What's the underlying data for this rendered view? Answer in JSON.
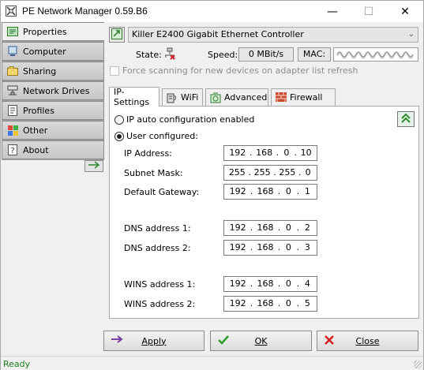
{
  "window": {
    "title": "PE Network Manager 0.59.B6",
    "min_glyph": "—",
    "max_glyph": "☐",
    "close_glyph": "✕"
  },
  "sidebar": {
    "items": [
      {
        "label": "Properties",
        "icon": "properties-icon",
        "active": true
      },
      {
        "label": "Computer",
        "icon": "computer-icon",
        "active": false
      },
      {
        "label": "Sharing",
        "icon": "sharing-icon",
        "active": false
      },
      {
        "label": "Network Drives",
        "icon": "network-drives-icon",
        "active": false
      },
      {
        "label": "Profiles",
        "icon": "profiles-icon",
        "active": false
      },
      {
        "label": "Other",
        "icon": "other-icon",
        "active": false
      },
      {
        "label": "About",
        "icon": "about-icon",
        "active": false
      }
    ]
  },
  "adapter": {
    "selected": "Killer E2400 Gigabit Ethernet Controller",
    "state_label": "State:",
    "speed_label": "Speed:",
    "speed_value": "0 MBit/s",
    "mac_label": "MAC:",
    "force_scan_label": "Force scanning for new devices on adapter list refresh",
    "force_scan_checked": false
  },
  "tabs": [
    {
      "label": "IP-Settings",
      "active": true
    },
    {
      "label": "WiFi",
      "active": false
    },
    {
      "label": "Advanced",
      "active": false
    },
    {
      "label": "Firewall",
      "active": false
    }
  ],
  "ip_settings": {
    "auto_label": "IP auto configuration enabled",
    "user_label": "User configured:",
    "mode": "user",
    "fields": [
      {
        "label": "IP Address:",
        "octets": [
          "192",
          "168",
          "0",
          "10"
        ]
      },
      {
        "label": "Subnet Mask:",
        "octets": [
          "255",
          "255",
          "255",
          "0"
        ]
      },
      {
        "label": "Default Gateway:",
        "octets": [
          "192",
          "168",
          "0",
          "1"
        ]
      },
      {
        "label": "DNS address 1:",
        "octets": [
          "192",
          "168",
          "0",
          "2"
        ]
      },
      {
        "label": "DNS address 2:",
        "octets": [
          "192",
          "168",
          "0",
          "3"
        ]
      },
      {
        "label": "WINS address 1:",
        "octets": [
          "192",
          "168",
          "0",
          "4"
        ]
      },
      {
        "label": "WINS address 2:",
        "octets": [
          "192",
          "168",
          "0",
          "5"
        ]
      }
    ]
  },
  "buttons": {
    "apply": "Apply",
    "ok": "OK",
    "close": "Close"
  },
  "status": {
    "text": "Ready"
  },
  "colors": {
    "status_green": "#1e7d1e",
    "apply_arrow": "#7a3fa6",
    "ok_check": "#2f9e2f",
    "close_x": "#d22020",
    "collapse_green": "#2d8a2d"
  }
}
